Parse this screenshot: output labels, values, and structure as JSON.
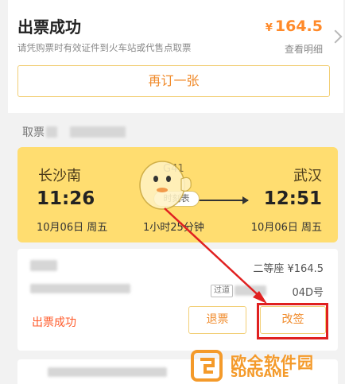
{
  "header": {
    "title": "出票成功",
    "subtitle": "请凭购票时有效证件到火车站或代售点取票",
    "price_currency": "¥",
    "price_value": "164.5",
    "view_detail": "查看明细",
    "rebook_label": "再订一张"
  },
  "pickup": {
    "label": "取票"
  },
  "trip": {
    "from_station": "长沙南",
    "to_station": "武汉",
    "train_no": "G41",
    "depart_time": "11:26",
    "arrive_time": "12:51",
    "depart_date": "10月06日 周五",
    "arrive_date": "10月06日 周五",
    "duration": "1小时25分钟",
    "timetable_label": "时刻表"
  },
  "passenger": {
    "seat_class_price": "二等座 ¥164.5",
    "pass_tag": "过道",
    "seat_location": "04D号",
    "ticket_status": "出票成功",
    "refund_label": "退票",
    "change_label": "改签"
  },
  "watermark": {
    "text": "欧全软件园",
    "sub": "SDNGAME"
  },
  "colors": {
    "accent": "#f08a2a",
    "price": "#ff8a2a",
    "status": "#ff5a2a",
    "trip_bg": "#ffdd70",
    "highlight": "#e02020"
  }
}
